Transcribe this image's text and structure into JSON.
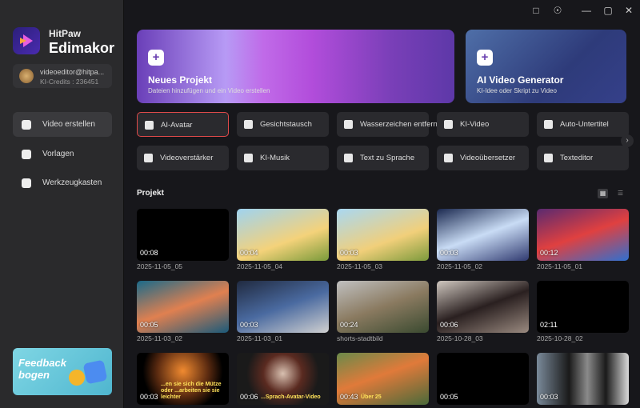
{
  "sidebar": {
    "brand_line1": "HitPaw",
    "brand_line2": "Edimakor",
    "user": {
      "email": "videoeditor@hitpa...",
      "credits": "KI-Credits : 236451"
    },
    "nav": [
      {
        "label": "Video erstellen",
        "icon": "video-create-icon",
        "active": true
      },
      {
        "label": "Vorlagen",
        "icon": "templates-icon"
      },
      {
        "label": "Werkzeugkasten",
        "icon": "toolbox-icon"
      }
    ],
    "feedback": "Feedback bogen"
  },
  "window": {
    "icons": [
      "feedback-icon",
      "settings-icon",
      "minimize-icon",
      "maximize-icon",
      "close-icon"
    ]
  },
  "cards": [
    {
      "title": "Neues Projekt",
      "subtitle": "Dateien hinzufügen und ein Video erstellen"
    },
    {
      "title": "AI Video Generator",
      "subtitle": "KI-Idee oder Skript zu Video"
    }
  ],
  "tools": [
    {
      "label": "AI-Avatar",
      "icon": "avatar-icon",
      "selected": true
    },
    {
      "label": "Gesichtstausch",
      "icon": "face-swap-icon"
    },
    {
      "label": "Wasserzeichen entfernen",
      "icon": "watermark-remove-icon"
    },
    {
      "label": "KI-Video",
      "icon": "ai-video-icon"
    },
    {
      "label": "Auto-Untertitel",
      "icon": "cc-icon"
    },
    {
      "label": "Videoverstärker",
      "icon": "enhancer-icon"
    },
    {
      "label": "KI-Musik",
      "icon": "music-icon"
    },
    {
      "label": "Text zu Sprache",
      "icon": "tts-icon"
    },
    {
      "label": "Videoübersetzer",
      "icon": "translate-icon"
    },
    {
      "label": "Texteditor",
      "icon": "text-editor-icon"
    }
  ],
  "projects_title": "Projekt",
  "projects": [
    {
      "duration": "00:08",
      "name": "2025-11-05_05",
      "bg": "#000000"
    },
    {
      "duration": "00:04",
      "name": "2025-11-05_04",
      "bg": "linear-gradient(160deg,#9fd3f0,#f4d27a 60%,#7a9a3a)"
    },
    {
      "duration": "00:03",
      "name": "2025-11-05_03",
      "bg": "linear-gradient(160deg,#a9d8f2,#f1cf7a 60%,#7c9a3c)"
    },
    {
      "duration": "00:03",
      "name": "2025-11-05_02",
      "bg": "linear-gradient(160deg,#1b2950,#c9dcf5 50%,#303a70)"
    },
    {
      "duration": "00:12",
      "name": "2025-11-05_01",
      "bg": "linear-gradient(160deg,#5a2a70,#e04040 50%,#3070d0)"
    },
    {
      "duration": "00:05",
      "name": "2025-11-03_02",
      "bg": "linear-gradient(160deg,#1a6a8a,#e08050 50%,#1a5a7a)"
    },
    {
      "duration": "00:03",
      "name": "2025-11-03_01",
      "bg": "linear-gradient(160deg,#202a40,#4a6aa0 50%,#d0d0d0)"
    },
    {
      "duration": "00:24",
      "name": "shorts-stadtbild",
      "bg": "linear-gradient(160deg,#c0c0c0,#8a7a60 50%,#3a4a30)"
    },
    {
      "duration": "00:06",
      "name": "2025-10-28_03",
      "bg": "linear-gradient(160deg,#d0c8c0,#2a2020 50%,#9a8a80)"
    },
    {
      "duration": "02:11",
      "name": "2025-10-28_02",
      "bg": "#000000"
    },
    {
      "duration": "00:03",
      "name": "",
      "caption": "...en sie sich die Mütze oder ...arbeiten sie sie leichter",
      "bg": "radial-gradient(circle at 50% 35%,#f08a30,#5a2a10 45%,#000 70%)"
    },
    {
      "duration": "00:06",
      "name": "",
      "caption": "...Sprach-Avatar-Video",
      "bg": "radial-gradient(circle at 50% 40%,#d8c0b0,#5a2a20 35%,#1a1a1a 65%)"
    },
    {
      "duration": "00:43",
      "name": "",
      "caption": "Über 25",
      "bg": "linear-gradient(160deg,#6a8a4a,#e07a3a 45%,#4a6a3a)"
    },
    {
      "duration": "00:05",
      "name": "",
      "bg": "#000000"
    },
    {
      "duration": "00:03",
      "name": "",
      "bg": "linear-gradient(90deg,#7a8a9a,#1a1a1a 35%,#8a8a8a 55%,#1a1a1a 75%,#dadada)"
    }
  ]
}
